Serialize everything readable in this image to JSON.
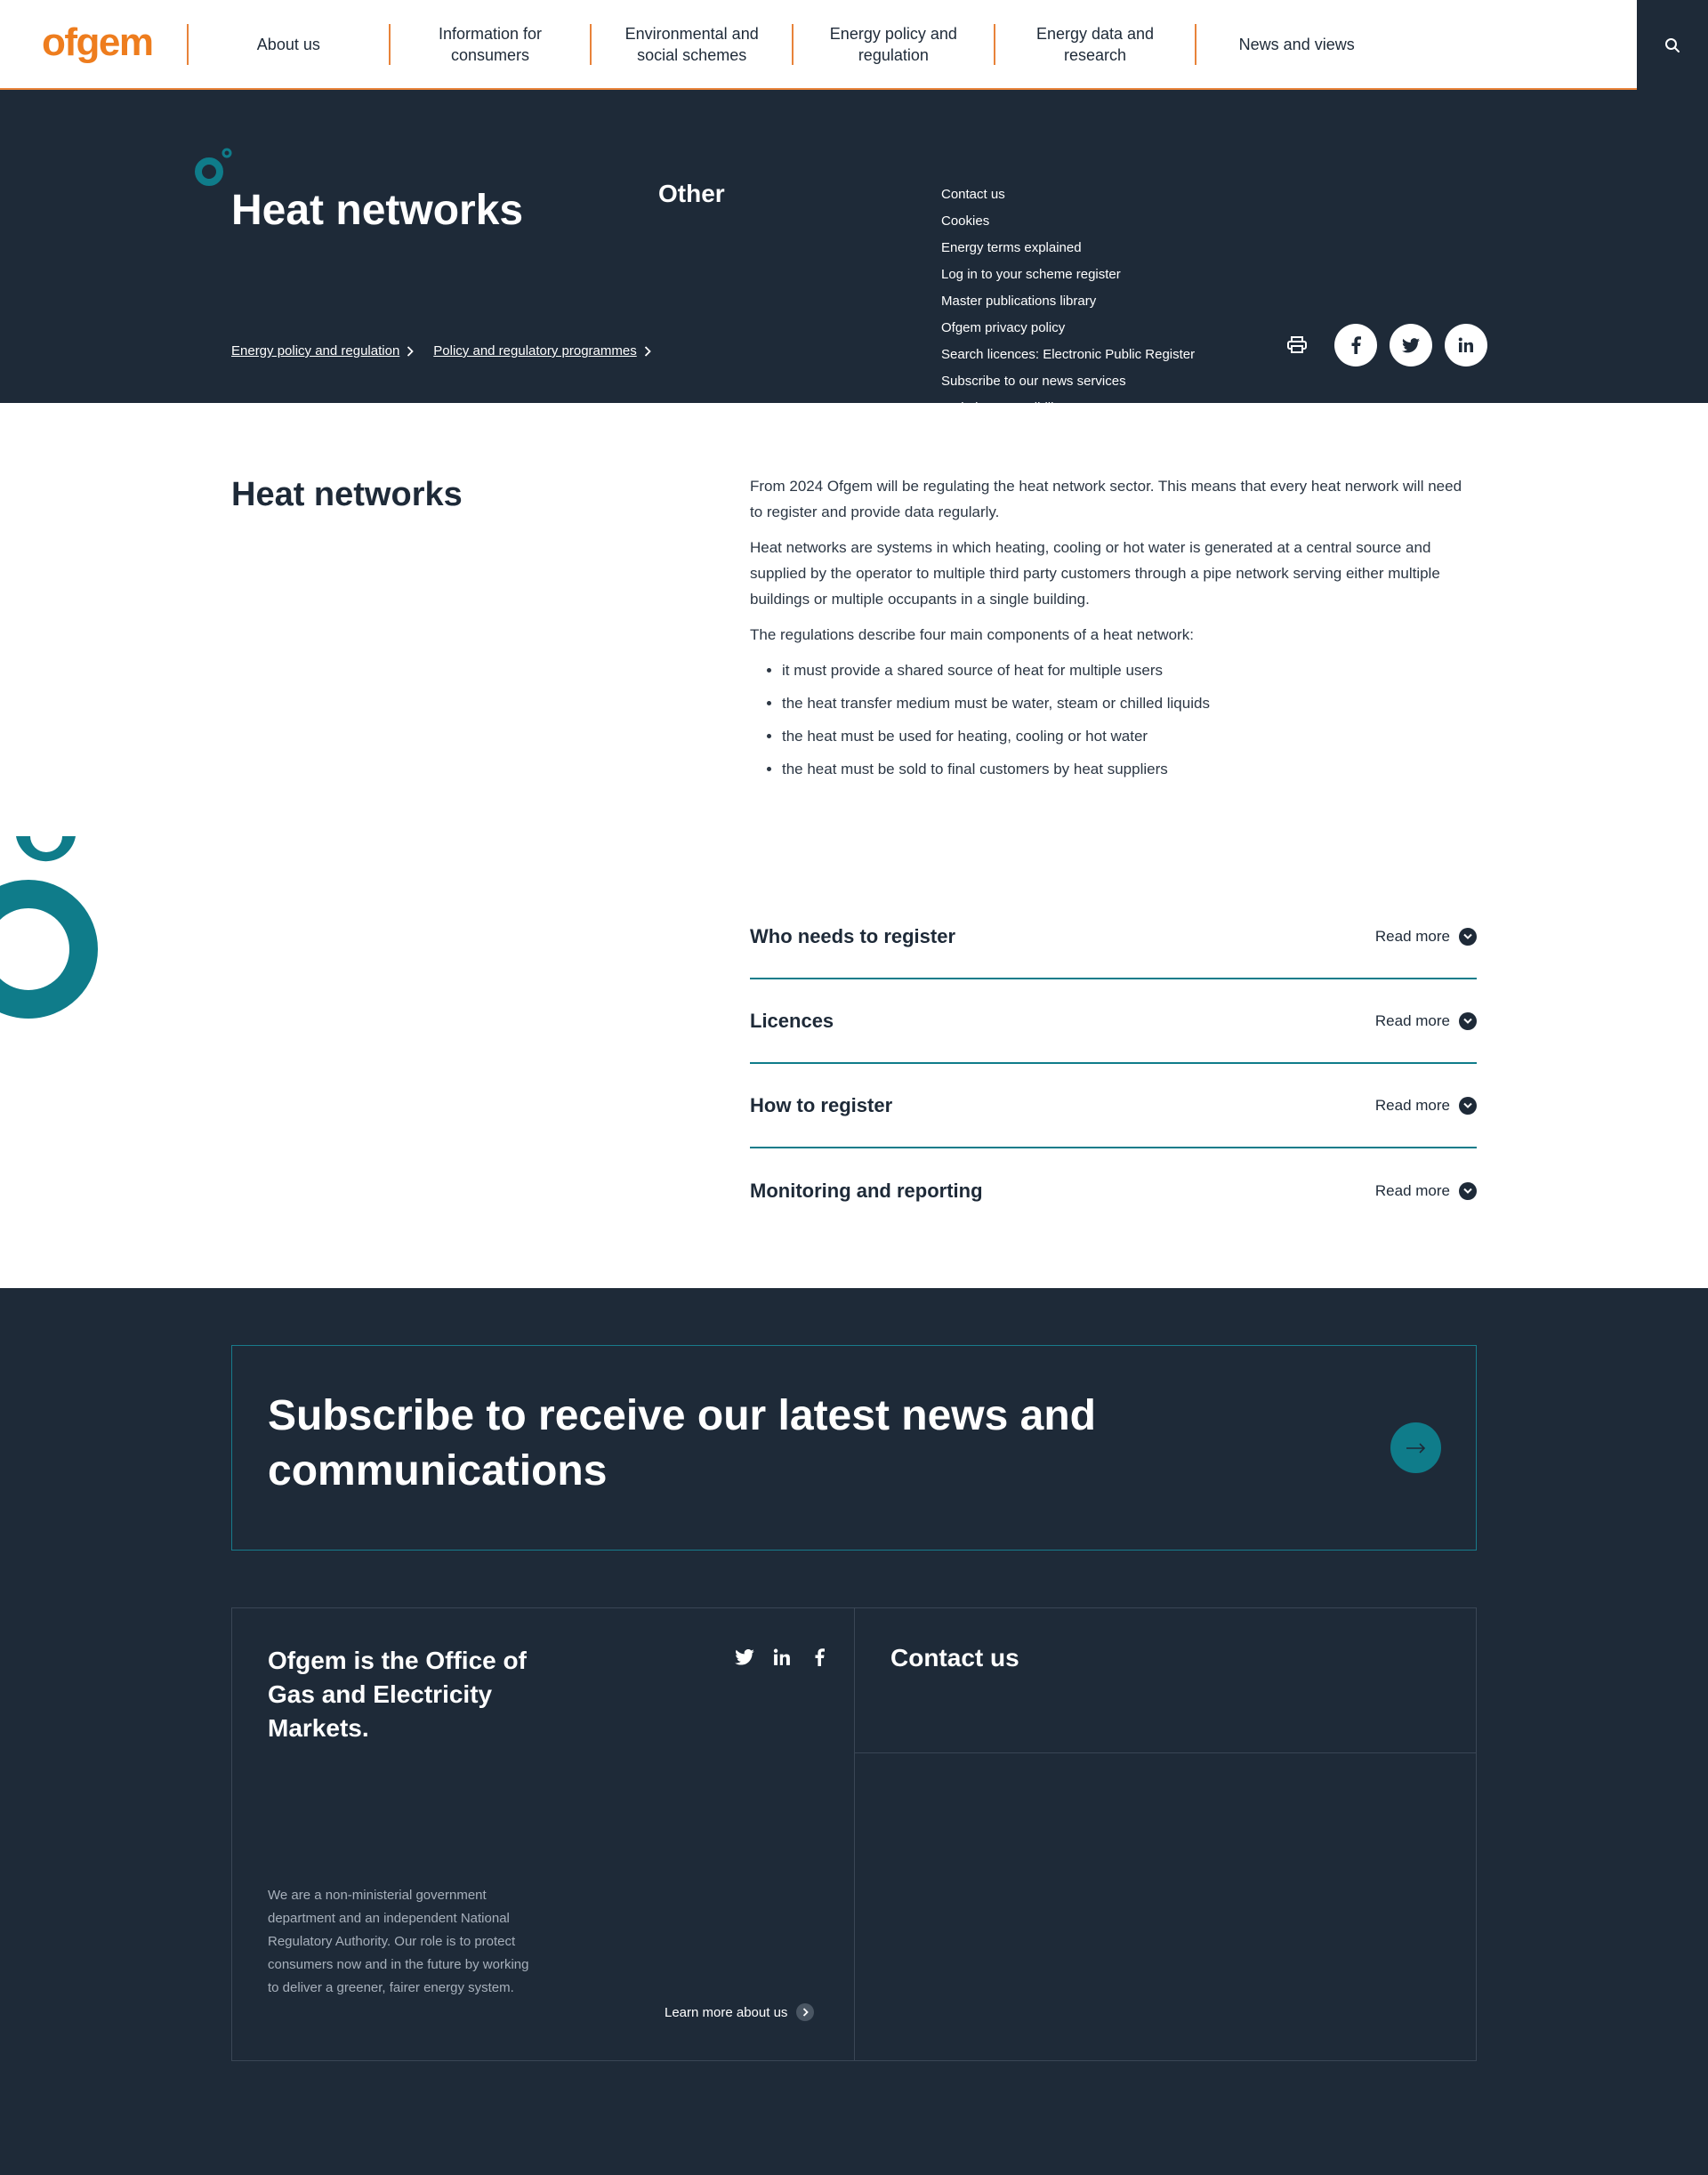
{
  "header": {
    "logo": "ofgem",
    "nav": [
      "About us",
      "Information for consumers",
      "Environmental and social schemes",
      "Energy policy and regulation",
      "Energy data and research",
      "News and views"
    ],
    "search_icon": "search-icon"
  },
  "hero": {
    "title": "Heat networks",
    "breadcrumb": [
      "Energy policy and regulation",
      "Policy and regulatory programmes"
    ],
    "share_icons": [
      "print-icon",
      "facebook-icon",
      "twitter-icon",
      "linkedin-icon"
    ]
  },
  "main": {
    "heading": "Heat networks",
    "paragraphs": [
      "From 2024 Ofgem will be regulating the heat network sector. This means that every heat nerwork will need to register and provide data regularly.",
      "Heat networks are systems in which heating, cooling or hot water is generated at a central source and supplied by the operator to multiple third party customers through a pipe network serving either multiple buildings or multiple occupants in a single building.",
      "The regulations describe four main components of a heat network:"
    ],
    "bullets": [
      "it must provide a shared source of heat for multiple users",
      "the heat transfer medium must be water, steam or chilled liquids",
      "the heat must be used for heating, cooling or hot water",
      "the heat must be sold to final customers by heat suppliers"
    ],
    "accordion": [
      {
        "title": "Who needs to register",
        "more": "Read more"
      },
      {
        "title": "Licences",
        "more": "Read more"
      },
      {
        "title": "How to register",
        "more": "Read more"
      },
      {
        "title": "Monitoring and reporting",
        "more": "Read more"
      }
    ]
  },
  "footer": {
    "subscribe": "Subscribe to receive our latest news and communications",
    "about_title": "Ofgem is the Office of Gas and Electricity Markets.",
    "about_desc": "We are a non-ministerial government department and an independent National Regulatory Authority. Our role is to protect consumers now and in the future by working to deliver a greener, fairer energy system.",
    "learn_more": "Learn more about us",
    "contact_title": "Contact us",
    "other_title": "Other",
    "other_links": [
      "Contact us",
      "Cookies",
      "Energy terms explained",
      "Log in to your scheme register",
      "Master publications library",
      "Ofgem privacy policy",
      "Search licences: Electronic Public Register",
      "Subscribe to our news services",
      "Website accessibility"
    ],
    "social_icons": [
      "twitter-icon",
      "linkedin-icon",
      "facebook-icon"
    ]
  },
  "colors": {
    "brand_orange": "#ee7d1e",
    "navy": "#1e2a38",
    "teal": "#0f7c8a"
  }
}
